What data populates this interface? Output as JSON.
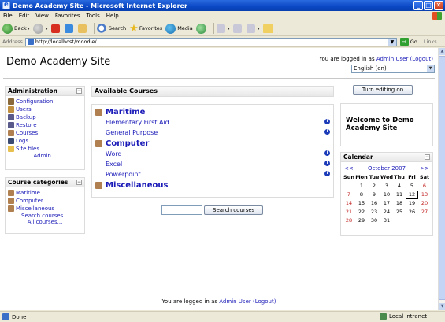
{
  "window": {
    "title": "Demo Academy Site - Microsoft Internet Explorer",
    "minimize": "_",
    "maximize": "□",
    "close": "✕"
  },
  "menubar": {
    "items": [
      "File",
      "Edit",
      "View",
      "Favorites",
      "Tools",
      "Help"
    ]
  },
  "toolbar": {
    "back": "Back",
    "search": "Search",
    "favorites": "Favorites",
    "media": "Media"
  },
  "address": {
    "label": "Address",
    "url": "http://localhost/moodle/",
    "go": "Go",
    "links": "Links"
  },
  "page": {
    "site_title": "Demo Academy Site",
    "login_prefix": "You are logged in as",
    "user": "Admin User",
    "logout": "(Logout)",
    "language": "English (en)",
    "edit_button": "Turn editing on"
  },
  "admin_block": {
    "title": "Administration",
    "items": [
      {
        "label": "Configuration",
        "icon": "config-icon"
      },
      {
        "label": "Users",
        "icon": "users-icon"
      },
      {
        "label": "Backup",
        "icon": "backup-icon"
      },
      {
        "label": "Restore",
        "icon": "restore-icon"
      },
      {
        "label": "Courses",
        "icon": "courses-icon"
      },
      {
        "label": "Logs",
        "icon": "logs-icon"
      },
      {
        "label": "Site files",
        "icon": "folder-icon"
      }
    ],
    "more": "Admin..."
  },
  "categories_block": {
    "title": "Course categories",
    "items": [
      "Maritime",
      "Computer",
      "Miscellaneous"
    ],
    "search": "Search courses...",
    "all": "All courses..."
  },
  "courses_block": {
    "title": "Available Courses",
    "categories": [
      {
        "name": "Maritime",
        "courses": [
          "Elementary First Aid",
          "General Purpose"
        ]
      },
      {
        "name": "Computer",
        "courses": [
          "Word",
          "Excel",
          "Powerpoint"
        ]
      },
      {
        "name": "Miscellaneous",
        "courses": []
      }
    ],
    "info_glyph": "i"
  },
  "search": {
    "button": "Search courses"
  },
  "welcome": {
    "text": "Welcome to Demo Academy Site"
  },
  "calendar": {
    "title": "Calendar",
    "prev": "<<",
    "month": "October 2007",
    "next": ">>",
    "day_headers": [
      "Sun",
      "Mon",
      "Tue",
      "Wed",
      "Thu",
      "Fri",
      "Sat"
    ],
    "weeks": [
      [
        "",
        "1",
        "2",
        "3",
        "4",
        "5",
        "6"
      ],
      [
        "7",
        "8",
        "9",
        "10",
        "11",
        "12",
        "13"
      ],
      [
        "14",
        "15",
        "16",
        "17",
        "18",
        "19",
        "20"
      ],
      [
        "21",
        "22",
        "23",
        "24",
        "25",
        "26",
        "27"
      ],
      [
        "28",
        "29",
        "30",
        "31",
        "",
        "",
        ""
      ]
    ],
    "today": "12"
  },
  "footer": {
    "prefix": "You are logged in as",
    "user": "Admin User",
    "logout": "(Logout)"
  },
  "status": {
    "text": "Done",
    "zone": "Local intranet"
  }
}
